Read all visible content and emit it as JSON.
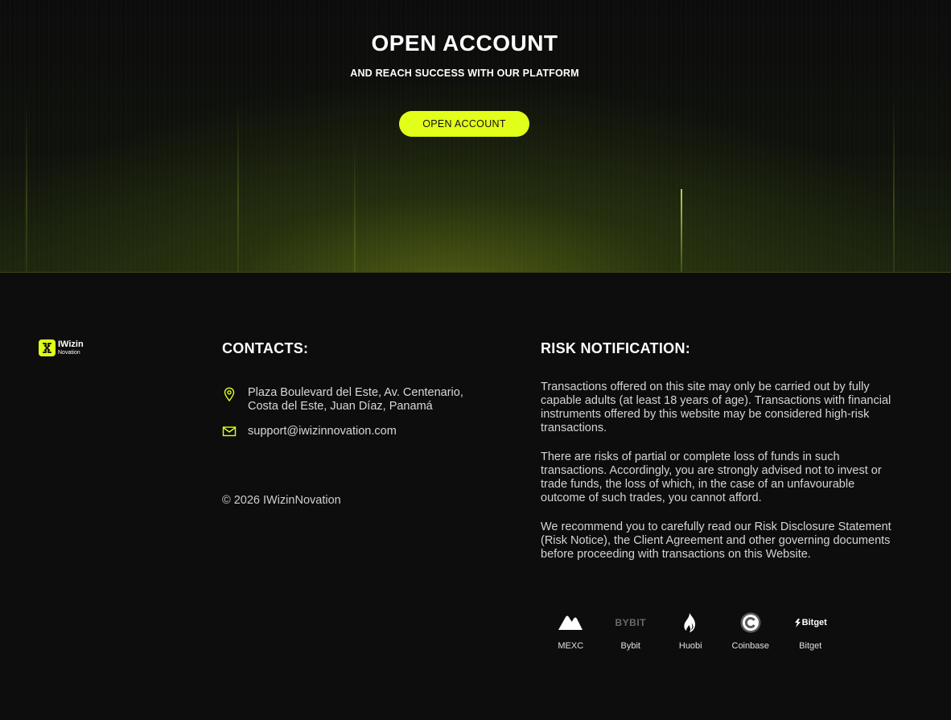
{
  "hero": {
    "title": "OPEN ACCOUNT",
    "subtitle": "AND REACH SUCCESS WITH OUR PLATFORM",
    "button_label": "OPEN ACCOUNT",
    "accent_color": "#e2ff1a"
  },
  "logo": {
    "line1": "IWizin",
    "line2": "Novation"
  },
  "contacts": {
    "title": "CONTACTS:",
    "address": "Plaza Boulevard del Este, Av. Centenario, Costa del Este, Juan Díaz, Panamá",
    "email": "support@iwizinnovation.com",
    "address_icon": "map-pin-icon",
    "email_icon": "mail-icon"
  },
  "copyright": "© 2026 IWizinNovation",
  "risk": {
    "title": "RISK NOTIFICATION:",
    "paragraphs": [
      "Transactions offered on this site may only be carried out by fully capable adults (at least 18 years of age). Transactions with financial instruments offered by this website may be considered high-risk transactions.",
      "There are risks of partial or complete loss of funds in such transactions. Accordingly, you are strongly advised not to invest or trade funds, the loss of which, in the case of an unfavourable outcome of such trades, you cannot afford.",
      "We recommend you to carefully read our Risk Disclosure Statement (Risk Notice), the Client Agreement and other governing documents before proceeding with transactions on this Website."
    ]
  },
  "partners": [
    {
      "name": "MEXC",
      "icon": "mexc-logo-icon"
    },
    {
      "name": "Bybit",
      "icon": "bybit-logo-icon",
      "logo_text": "BYBIT"
    },
    {
      "name": "Huobi",
      "icon": "huobi-logo-icon"
    },
    {
      "name": "Coinbase",
      "icon": "coinbase-logo-icon"
    },
    {
      "name": "Bitget",
      "icon": "bitget-logo-icon",
      "logo_text": "Bitget"
    }
  ]
}
